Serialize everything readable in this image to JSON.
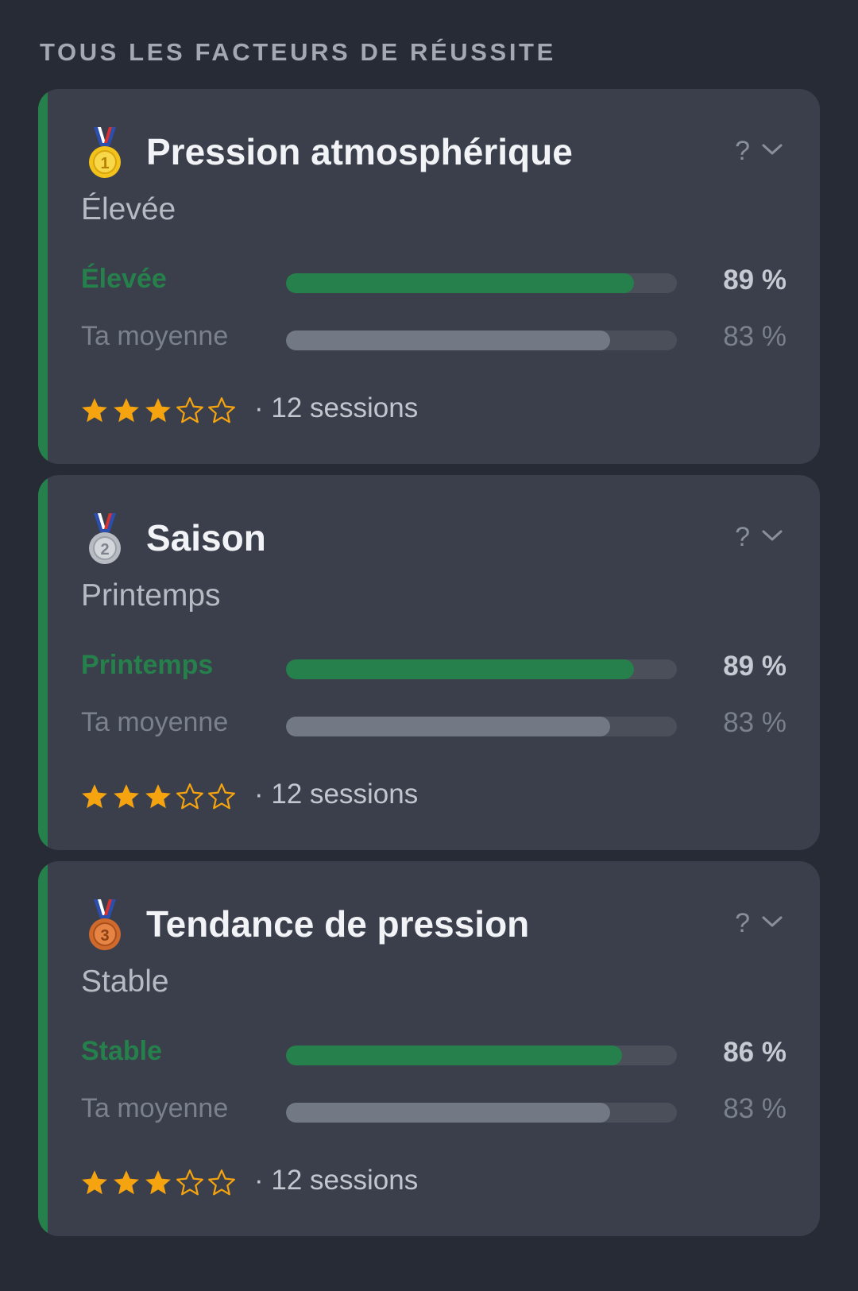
{
  "section_title": "TOUS LES FACTEURS DE RÉUSSITE",
  "colors": {
    "accent_green": "#25804b",
    "avg_bar": "#727985",
    "star_gold": "#f5a30f",
    "background": "#272b35",
    "card": "#3a3f4b"
  },
  "factors": [
    {
      "medal_icon": "gold-medal-icon",
      "medal_rank": "1",
      "title": "Pression atmosphérique",
      "help": "?",
      "value": "Élevée",
      "main_label": "Élevée",
      "main_percent": "89 %",
      "main_fraction": 0.89,
      "avg_label": "Ta moyenne",
      "avg_percent": "83 %",
      "avg_fraction": 0.83,
      "rating": 3,
      "rating_max": 5,
      "sessions": "· 12 sessions"
    },
    {
      "medal_icon": "silver-medal-icon",
      "medal_rank": "2",
      "title": "Saison",
      "help": "?",
      "value": "Printemps",
      "main_label": "Printemps",
      "main_percent": "89 %",
      "main_fraction": 0.89,
      "avg_label": "Ta moyenne",
      "avg_percent": "83 %",
      "avg_fraction": 0.83,
      "rating": 3,
      "rating_max": 5,
      "sessions": "· 12 sessions"
    },
    {
      "medal_icon": "bronze-medal-icon",
      "medal_rank": "3",
      "title": "Tendance de pression",
      "help": "?",
      "value": "Stable",
      "main_label": "Stable",
      "main_percent": "86 %",
      "main_fraction": 0.86,
      "avg_label": "Ta moyenne",
      "avg_percent": "83 %",
      "avg_fraction": 0.83,
      "rating": 3,
      "rating_max": 5,
      "sessions": "· 12 sessions"
    }
  ]
}
